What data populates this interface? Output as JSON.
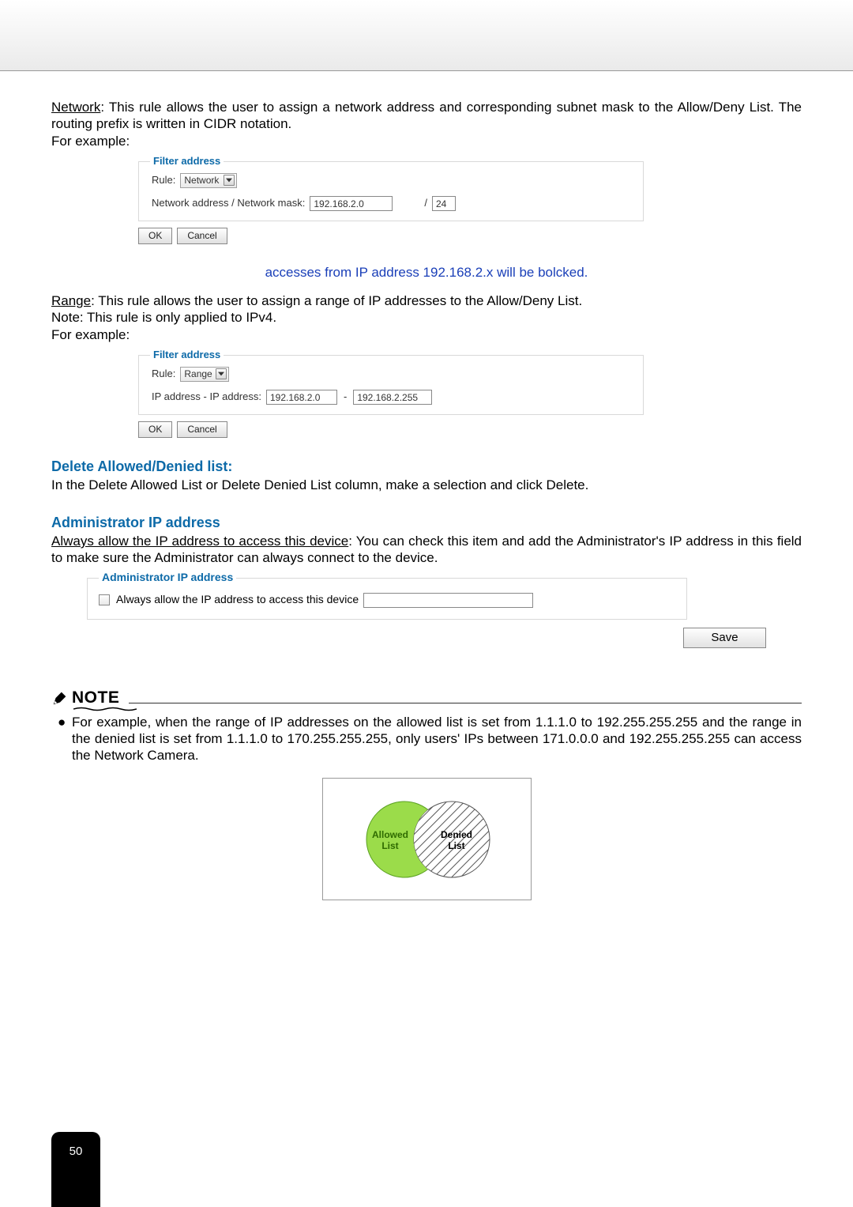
{
  "paragraphs": {
    "network_desc": ": This rule allows the user to assign a network address and corresponding subnet mask to the Allow/Deny List. The routing prefix is written in CIDR notation.",
    "network_label": "Network",
    "for_example": "For example:",
    "range_label": "Range",
    "range_desc": ": This rule allows the user to assign a range of IP addresses to the Allow/Deny List.",
    "range_note": "Note: This rule is only applied to IPv4.",
    "delete_desc": "In the Delete Allowed List or Delete Denied List column, make a selection and click Delete.",
    "admin_label": "Always allow the IP address to access this device",
    "admin_desc": ": You can check this item and add the Administrator's IP address in this field to make sure the Administrator can always connect to the device."
  },
  "headings": {
    "delete": "Delete Allowed/Denied list:",
    "admin": "Administrator IP address"
  },
  "fieldset_network": {
    "legend": "Filter address",
    "rule_label": "Rule:",
    "rule_value": "Network",
    "addr_label": "Network address / Network mask:",
    "addr_value": "192.168.2.0",
    "mask_sep": "/",
    "mask_value": "24"
  },
  "fieldset_range": {
    "legend": "Filter address",
    "rule_label": "Rule:",
    "rule_value": "Range",
    "addr_label": "IP address - IP address:",
    "addr_from": "192.168.2.0",
    "sep": "-",
    "addr_to": "192.168.2.255"
  },
  "buttons": {
    "ok": "OK",
    "cancel": "Cancel",
    "save": "Save"
  },
  "caption_network": "accesses from IP address 192.168.2.x will be bolcked.",
  "admin_fieldset": {
    "legend": "Administrator IP address",
    "check_label": "Always allow the IP address to access this device"
  },
  "note": {
    "label": "NOTE",
    "bullet1": "For example, when the range of IP addresses on the allowed list is set from 1.1.1.0 to 192.255.255.255 and the range in the denied list is set from 1.1.1.0 to 170.255.255.255, only users' IPs between 171.0.0.0 and 192.255.255.255 can access the Network Camera."
  },
  "venn": {
    "allowed": "Allowed",
    "list": "List",
    "denied": "Denied"
  },
  "page_number": "50"
}
